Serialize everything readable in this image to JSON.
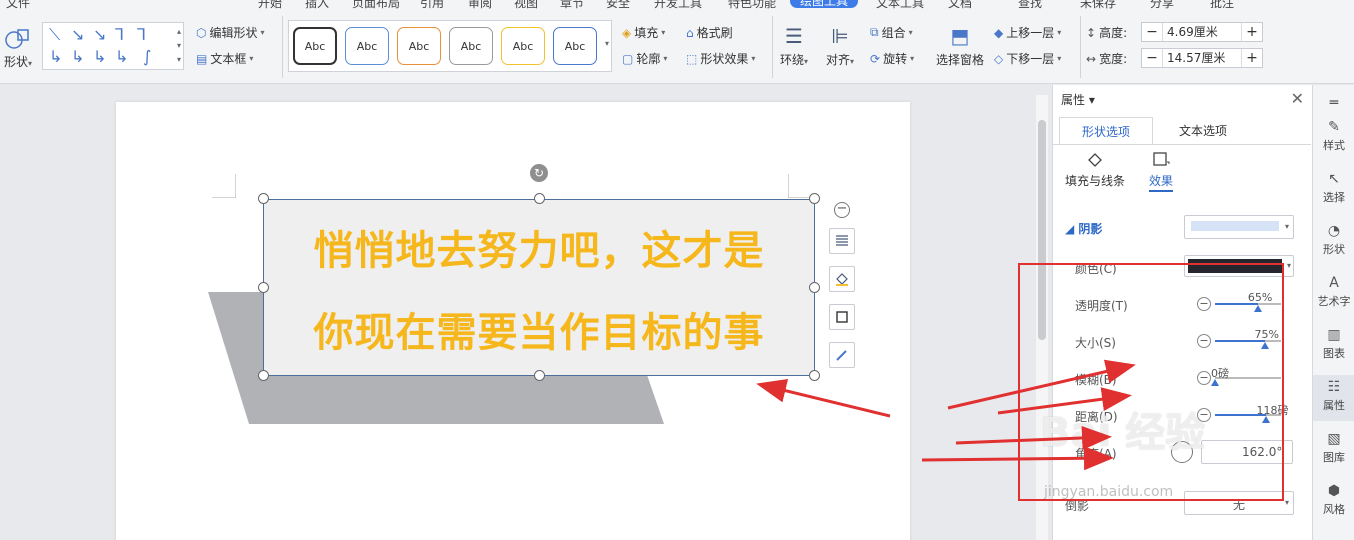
{
  "menu_tabs": [
    "文件",
    "开始",
    "插入",
    "页面布局",
    "引用",
    "审阅",
    "视图",
    "章节",
    "安全",
    "开发工具",
    "特色功能",
    "绘图工具",
    "文本工具",
    "文档",
    "查找",
    "未保存",
    "分享",
    "批注"
  ],
  "active_menu_tab": "绘图工具",
  "ribbon": {
    "shape_label": "形状",
    "edit_shape": "编辑形状",
    "text_box": "文本框",
    "style_samples": [
      "Abc",
      "Abc",
      "Abc",
      "Abc",
      "Abc",
      "Abc"
    ],
    "style_colors": [
      "#333333",
      "#5b8fd6",
      "#e8903a",
      "#9a9a9a",
      "#f2c230",
      "#4a78c8"
    ],
    "fill": "填充",
    "format_painter": "格式刷",
    "outline": "轮廓",
    "shape_effects": "形状效果",
    "wrap": "环绕",
    "align": "对齐",
    "group": "组合",
    "rotate": "旋转",
    "selection_pane": "选择窗格",
    "bring_forward": "上移一层",
    "send_backward": "下移一层",
    "height_label": "高度:",
    "height_value": "4.69厘米",
    "width_label": "宽度:",
    "width_value": "14.57厘米"
  },
  "document": {
    "text_line1": "悄悄地去努力吧，这才是",
    "text_line2": "你现在需要当作目标的事",
    "text_color": "#f5b71c"
  },
  "panel": {
    "title": "属性",
    "tab_shape": "形状选项",
    "tab_text": "文本选项",
    "sub_fill": "填充与线条",
    "sub_effect": "效果",
    "section_shadow": "阴影",
    "rows": [
      {
        "label": "颜色(C)"
      },
      {
        "label": "透明度(T)",
        "value": "65%",
        "level": 0.65
      },
      {
        "label": "大小(S)",
        "value": "75%",
        "level": 0.75
      },
      {
        "label": "模糊(B)",
        "value": "0磅",
        "level": 0.0
      },
      {
        "label": "距离(D)",
        "value": "118磅",
        "level": 0.78
      },
      {
        "label": "角度(A)",
        "value": "162.0°"
      },
      {
        "label": "倒影",
        "value": "无"
      }
    ]
  },
  "sidebar": [
    "样式",
    "选择",
    "形状",
    "艺术字",
    "图表",
    "属性",
    "图库",
    "风格"
  ],
  "active_sidebar": "属性",
  "watermark": "Bai 经验",
  "watermark_url": "jingyan.baidu.com"
}
